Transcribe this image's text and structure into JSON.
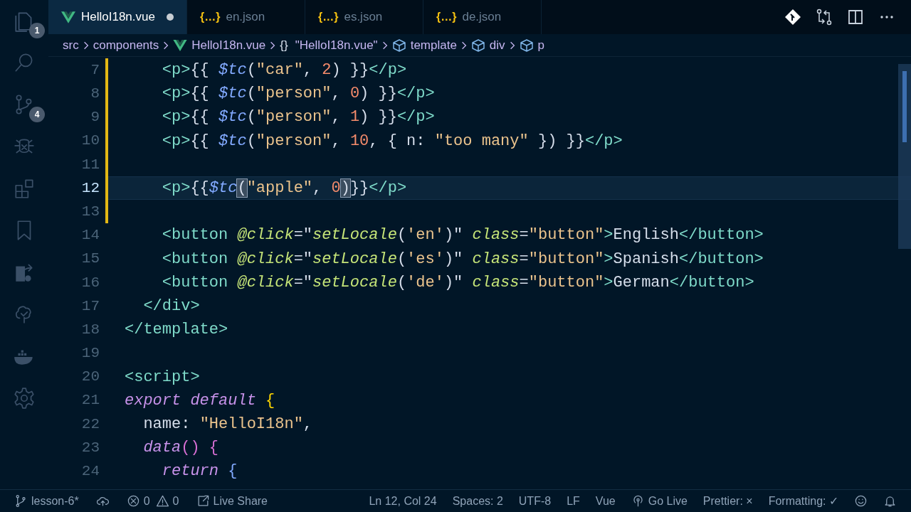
{
  "activity_bar": [
    {
      "kind": "files",
      "badge": "1"
    },
    {
      "kind": "search"
    },
    {
      "kind": "branch",
      "badge": "4"
    },
    {
      "kind": "bug"
    },
    {
      "kind": "blocks"
    },
    {
      "kind": "bookmark"
    },
    {
      "kind": "share"
    },
    {
      "kind": "tree"
    },
    {
      "kind": "whale"
    },
    {
      "kind": "gear"
    }
  ],
  "tabs": [
    {
      "label": "HelloI18n.vue",
      "kind": "vue",
      "selected": true,
      "dirty": true
    },
    {
      "label": "en.json",
      "kind": "json",
      "icon": "{…}",
      "selected": false,
      "dirty": false
    },
    {
      "label": "es.json",
      "kind": "json",
      "icon": "{…}",
      "selected": false,
      "dirty": false
    },
    {
      "label": "de.json",
      "kind": "json",
      "icon": "{…}",
      "selected": false,
      "dirty": false
    }
  ],
  "toolbar": [
    {
      "kind": "git"
    },
    {
      "kind": "compare"
    },
    {
      "kind": "split"
    },
    {
      "kind": "more"
    }
  ],
  "breadcrumb": [
    {
      "label": "src",
      "kind": "text"
    },
    {
      "label": "components",
      "kind": "text"
    },
    {
      "label": "HelloI18n.vue",
      "kind": "vue"
    },
    {
      "label": "\"HelloI18n.vue\"",
      "kind": "braces",
      "icon": "{}"
    },
    {
      "label": "template",
      "kind": "cube"
    },
    {
      "label": "div",
      "kind": "cube"
    },
    {
      "label": "p",
      "kind": "cube"
    }
  ],
  "lines": [
    {
      "number": "7",
      "modified": true,
      "current": false,
      "tokens": [
        {
          "kind": "tag",
          "s": "    <p>"
        },
        {
          "kind": "punct",
          "s": "{{ "
        },
        {
          "kind": "fn",
          "s": "$tc"
        },
        {
          "kind": "punct",
          "s": "("
        },
        {
          "kind": "str",
          "s": "\"car\""
        },
        {
          "kind": "punct",
          "s": ", "
        },
        {
          "kind": "num",
          "s": "2"
        },
        {
          "kind": "punct",
          "s": ") }}"
        },
        {
          "kind": "tag",
          "s": "</p>"
        }
      ]
    },
    {
      "number": "8",
      "modified": true,
      "current": false,
      "tokens": [
        {
          "kind": "tag",
          "s": "    <p>"
        },
        {
          "kind": "punct",
          "s": "{{ "
        },
        {
          "kind": "fn",
          "s": "$tc"
        },
        {
          "kind": "punct",
          "s": "("
        },
        {
          "kind": "str",
          "s": "\"person\""
        },
        {
          "kind": "punct",
          "s": ", "
        },
        {
          "kind": "num",
          "s": "0"
        },
        {
          "kind": "punct",
          "s": ") }}"
        },
        {
          "kind": "tag",
          "s": "</p>"
        }
      ]
    },
    {
      "number": "9",
      "modified": true,
      "current": false,
      "tokens": [
        {
          "kind": "tag",
          "s": "    <p>"
        },
        {
          "kind": "punct",
          "s": "{{ "
        },
        {
          "kind": "fn",
          "s": "$tc"
        },
        {
          "kind": "punct",
          "s": "("
        },
        {
          "kind": "str",
          "s": "\"person\""
        },
        {
          "kind": "punct",
          "s": ", "
        },
        {
          "kind": "num",
          "s": "1"
        },
        {
          "kind": "punct",
          "s": ") }}"
        },
        {
          "kind": "tag",
          "s": "</p>"
        }
      ]
    },
    {
      "number": "10",
      "modified": true,
      "current": false,
      "tokens": [
        {
          "kind": "tag",
          "s": "    <p>"
        },
        {
          "kind": "punct",
          "s": "{{ "
        },
        {
          "kind": "fn",
          "s": "$tc"
        },
        {
          "kind": "punct",
          "s": "("
        },
        {
          "kind": "str",
          "s": "\"person\""
        },
        {
          "kind": "punct",
          "s": ", "
        },
        {
          "kind": "num",
          "s": "10"
        },
        {
          "kind": "punct",
          "s": ", { n: "
        },
        {
          "kind": "str",
          "s": "\"too many\""
        },
        {
          "kind": "punct",
          "s": " }) }}"
        },
        {
          "kind": "tag",
          "s": "</p>"
        }
      ]
    },
    {
      "number": "11",
      "modified": true,
      "current": false
    },
    {
      "number": "12",
      "modified": true,
      "current": true,
      "tokens": [
        {
          "kind": "tag",
          "s": "    <p>"
        },
        {
          "kind": "punct",
          "s": "{{"
        },
        {
          "kind": "fn",
          "s": "$tc"
        },
        {
          "kind": "match",
          "s": "("
        },
        {
          "kind": "str",
          "s": "\"apple\""
        },
        {
          "kind": "punct",
          "s": ", "
        },
        {
          "kind": "num",
          "s": "0"
        },
        {
          "kind": "match",
          "s": ")"
        },
        {
          "kind": "punct",
          "s": "}}"
        },
        {
          "kind": "tag",
          "s": "</p>"
        }
      ]
    },
    {
      "number": "13",
      "modified": true,
      "current": false
    },
    {
      "number": "14",
      "modified": false,
      "current": false,
      "tokens": [
        {
          "kind": "tag",
          "s": "    <button "
        },
        {
          "kind": "attr",
          "s": "@click"
        },
        {
          "kind": "punct",
          "s": "=\""
        },
        {
          "kind": "method",
          "s": "setLocale"
        },
        {
          "kind": "punct",
          "s": "("
        },
        {
          "kind": "str",
          "s": "'en'"
        },
        {
          "kind": "punct",
          "s": ")\" "
        },
        {
          "kind": "attr",
          "s": "class"
        },
        {
          "kind": "punct",
          "s": "="
        },
        {
          "kind": "str",
          "s": "\"button\""
        },
        {
          "kind": "tag",
          "s": ">"
        },
        {
          "kind": "plain",
          "s": "English"
        },
        {
          "kind": "tag",
          "s": "</button>"
        }
      ]
    },
    {
      "number": "15",
      "modified": false,
      "current": false,
      "tokens": [
        {
          "kind": "tag",
          "s": "    <button "
        },
        {
          "kind": "attr",
          "s": "@click"
        },
        {
          "kind": "punct",
          "s": "=\""
        },
        {
          "kind": "method",
          "s": "setLocale"
        },
        {
          "kind": "punct",
          "s": "("
        },
        {
          "kind": "str",
          "s": "'es'"
        },
        {
          "kind": "punct",
          "s": ")\" "
        },
        {
          "kind": "attr",
          "s": "class"
        },
        {
          "kind": "punct",
          "s": "="
        },
        {
          "kind": "str",
          "s": "\"button\""
        },
        {
          "kind": "tag",
          "s": ">"
        },
        {
          "kind": "plain",
          "s": "Spanish"
        },
        {
          "kind": "tag",
          "s": "</button>"
        }
      ]
    },
    {
      "number": "16",
      "modified": false,
      "current": false,
      "tokens": [
        {
          "kind": "tag",
          "s": "    <button "
        },
        {
          "kind": "attr",
          "s": "@click"
        },
        {
          "kind": "punct",
          "s": "=\""
        },
        {
          "kind": "method",
          "s": "setLocale"
        },
        {
          "kind": "punct",
          "s": "("
        },
        {
          "kind": "str",
          "s": "'de'"
        },
        {
          "kind": "punct",
          "s": ")\" "
        },
        {
          "kind": "attr",
          "s": "class"
        },
        {
          "kind": "punct",
          "s": "="
        },
        {
          "kind": "str",
          "s": "\"button\""
        },
        {
          "kind": "tag",
          "s": ">"
        },
        {
          "kind": "plain",
          "s": "German"
        },
        {
          "kind": "tag",
          "s": "</button>"
        }
      ]
    },
    {
      "number": "17",
      "modified": false,
      "current": false,
      "tokens": [
        {
          "kind": "tag",
          "s": "  </div>"
        }
      ]
    },
    {
      "number": "18",
      "modified": false,
      "current": false,
      "tokens": [
        {
          "kind": "tag",
          "s": "</template>"
        }
      ]
    },
    {
      "number": "19",
      "modified": false,
      "current": false
    },
    {
      "number": "20",
      "modified": false,
      "current": false,
      "tokens": [
        {
          "kind": "tag",
          "s": "<script>"
        }
      ]
    },
    {
      "number": "21",
      "modified": false,
      "current": false,
      "tokens": [
        {
          "kind": "kw",
          "s": "export default "
        },
        {
          "kind": "brace1",
          "s": "{"
        }
      ]
    },
    {
      "number": "22",
      "modified": false,
      "current": false,
      "tokens": [
        {
          "kind": "plain",
          "s": "  name: "
        },
        {
          "kind": "str",
          "s": "\"HelloI18n\""
        },
        {
          "kind": "punct",
          "s": ","
        }
      ]
    },
    {
      "number": "23",
      "modified": false,
      "current": false,
      "tokens": [
        {
          "kind": "kw",
          "s": "  data"
        },
        {
          "kind": "brace2",
          "s": "() {"
        }
      ]
    },
    {
      "number": "24",
      "modified": false,
      "current": false,
      "tokens": [
        {
          "kind": "kw",
          "s": "    return "
        },
        {
          "kind": "brace3",
          "s": "{"
        }
      ]
    }
  ],
  "status_bar": {
    "left": [
      {
        "kind": "branch",
        "label": "lesson-6*"
      },
      {
        "kind": "cloud"
      },
      {
        "kind": "error",
        "label": "0"
      },
      {
        "kind": "warning",
        "label": "0"
      },
      {
        "kind": "liveshare",
        "label": "Live Share"
      }
    ],
    "right": [
      {
        "kind": "text",
        "label": "Ln 12, Col 24"
      },
      {
        "kind": "text",
        "label": "Spaces: 2"
      },
      {
        "kind": "text",
        "label": "UTF-8"
      },
      {
        "kind": "text",
        "label": "LF"
      },
      {
        "kind": "text",
        "label": "Vue"
      },
      {
        "kind": "broadcast",
        "label": "Go Live"
      },
      {
        "kind": "text",
        "label": "Prettier: ×"
      },
      {
        "kind": "text",
        "label": "Formatting: ✓"
      },
      {
        "kind": "smiley"
      },
      {
        "kind": "bell"
      }
    ]
  }
}
